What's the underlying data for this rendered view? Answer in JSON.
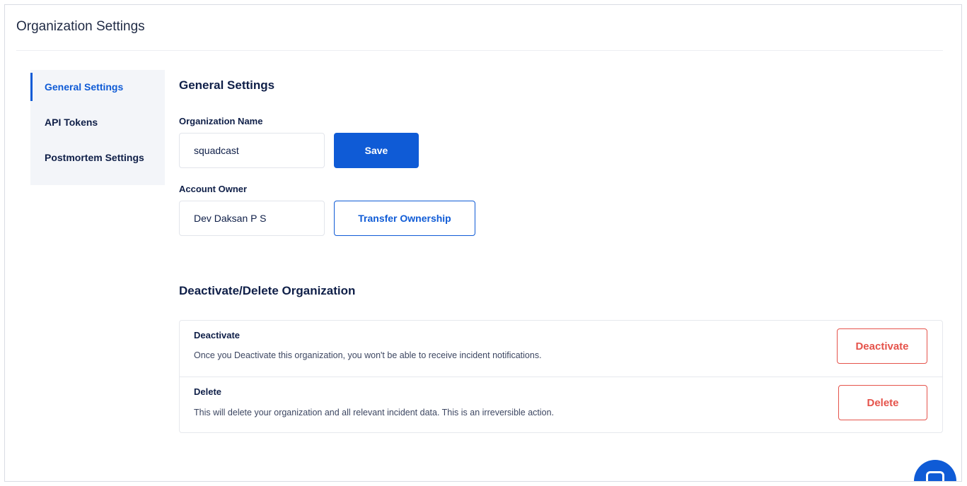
{
  "header": {
    "title": "Organization Settings"
  },
  "sidebar": {
    "items": [
      {
        "label": "General Settings"
      },
      {
        "label": "API Tokens"
      },
      {
        "label": "Postmortem Settings"
      }
    ]
  },
  "general": {
    "heading": "General Settings",
    "org_name_label": "Organization Name",
    "org_name_value": "squadcast",
    "save_label": "Save",
    "owner_label": "Account Owner",
    "owner_value": "Dev Daksan P S",
    "transfer_label": "Transfer Ownership"
  },
  "danger": {
    "heading": "Deactivate/Delete Organization",
    "deactivate": {
      "title": "Deactivate",
      "description": "Once you Deactivate this organization, you won't be able to receive incident notifications.",
      "button": "Deactivate"
    },
    "delete": {
      "title": "Delete",
      "description": "This will delete your organization and all relevant incident data. This is an irreversible action.",
      "button": "Delete"
    }
  },
  "colors": {
    "primary": "#0f5bd6",
    "danger": "#e5534b",
    "text": "#0f1f48"
  },
  "icons": {
    "chat": "chat-icon"
  }
}
